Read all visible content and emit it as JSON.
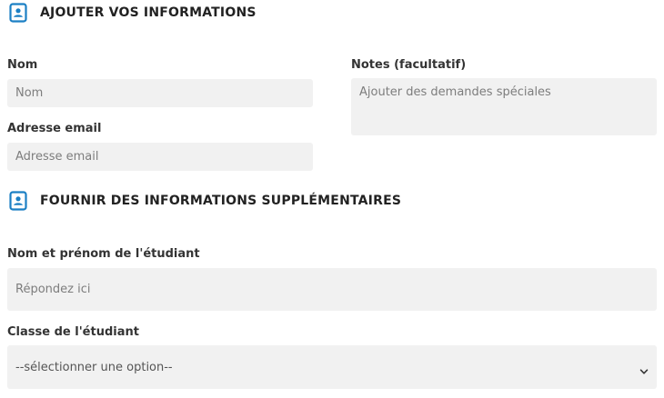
{
  "section1": {
    "icon": "contact-book-icon",
    "title": "AJOUTER VOS INFORMATIONS"
  },
  "name_field": {
    "label": "Nom",
    "placeholder": "Nom"
  },
  "email_field": {
    "label": "Adresse email",
    "placeholder": "Adresse email"
  },
  "notes_field": {
    "label": "Notes (facultatif)",
    "placeholder": "Ajouter des demandes spéciales"
  },
  "section2": {
    "icon": "contact-book-icon",
    "title": "FOURNIR DES INFORMATIONS SUPPLÉMENTAIRES"
  },
  "student_name_field": {
    "label": "Nom et prénom de l'étudiant",
    "placeholder": "Répondez ici"
  },
  "student_class_field": {
    "label": "Classe de l'étudiant",
    "selected": "--sélectionner une option--",
    "icon": "chevron-down-icon"
  },
  "colors": {
    "accent": "#1b7fc4",
    "field_bg": "#f1f1f1"
  }
}
